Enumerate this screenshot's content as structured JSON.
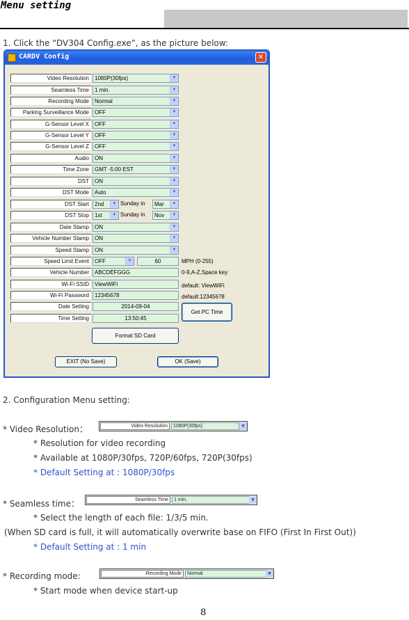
{
  "header": {
    "title": "Menu setting"
  },
  "step1": "1. Click the “DV304 Config.exe”, as the picture below:",
  "window": {
    "title": "CARDV Config",
    "close": "✕",
    "rows": [
      {
        "label": "Video Resolution",
        "value": "1080P(30fps)"
      },
      {
        "label": "Seamless Time",
        "value": "1 min."
      },
      {
        "label": "Recording Mode",
        "value": "Normal"
      },
      {
        "label": "Parking Surveillance Mode",
        "value": "OFF"
      },
      {
        "label": "G-Sensor Level X",
        "value": "OFF"
      },
      {
        "label": "G-Sensor Level Y",
        "value": "OFF"
      },
      {
        "label": "G-Sensor Level Z",
        "value": "OFF"
      },
      {
        "label": "Audio",
        "value": "ON"
      },
      {
        "label": "Time Zone",
        "value": "GMT -5:00 EST"
      },
      {
        "label": "DST",
        "value": "ON"
      },
      {
        "label": "DST Mode",
        "value": "Auto"
      },
      {
        "label": "DST Start",
        "value": "2nd",
        "mid": "Sunday in",
        "month": "Mar"
      },
      {
        "label": "DST Stop",
        "value": "1st",
        "mid": "Sunday in",
        "month": "Nov"
      },
      {
        "label": "Date Stamp",
        "value": "ON"
      },
      {
        "label": "Vehicle Number Stamp",
        "value": "ON"
      },
      {
        "label": "Speed Stamp",
        "value": "ON"
      },
      {
        "label": "Speed Limit Event",
        "value": "OFF",
        "limit": "60",
        "hint": "MPH (0-255)"
      },
      {
        "label": "Vehicle Number",
        "value": "ABCDEFGGG",
        "hint": "0-9,A-Z,Space key"
      },
      {
        "label": "Wi-Fi SSID",
        "value": "ViewWiFi",
        "hint": "default: ViewWiFi"
      },
      {
        "label": "Wi-Fi Password",
        "value": "12345678",
        "hint": "default:12345678"
      },
      {
        "label": "Date Setting",
        "value": "2014-09-04"
      },
      {
        "label": "Time Setting",
        "value": "13:50:45"
      }
    ],
    "get_pc_time": "Get PC Time",
    "format_sd": "Format SD Card",
    "exit": "EXIT (No Save)",
    "ok": "OK (Save)"
  },
  "section2": "2. Configuration Menu setting:",
  "video": {
    "heading": "* Video Resolution：",
    "label": "Video Resolution",
    "value": "1080P(30fps)",
    "b1": "* Resolution for video recording",
    "b2": "* Available at 1080P/30fps, 720P/60fps, 720P(30fps)",
    "b3": "* Default Setting at : 1080P/30fps"
  },
  "seamless": {
    "heading": "* Seamless time：",
    "label": "Seamless Time",
    "value": "1 min.",
    "b1": "* Select the length of each file: 1/3/5 min.",
    "b2": "(When SD card is full, it will automatically overwrite base on FIFO (First In First Out))",
    "b3": "* Default Setting at : 1 min"
  },
  "recording": {
    "heading": "* Recording mode:",
    "label": "Recording Mode",
    "value": "Normal",
    "b1": "* Start mode when device start-up"
  },
  "page_number": "8"
}
